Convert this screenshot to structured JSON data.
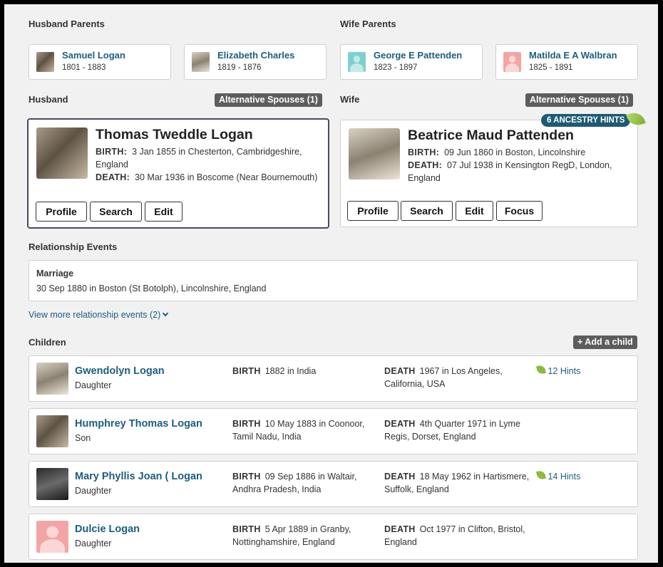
{
  "husband_parents": {
    "label": "Husband Parents",
    "father": {
      "name": "Samuel Logan",
      "dates": "1801 - 1883"
    },
    "mother": {
      "name": "Elizabeth Charles",
      "dates": "1819 - 1876"
    }
  },
  "wife_parents": {
    "label": "Wife Parents",
    "father": {
      "name": "George E Pattenden",
      "dates": "1823 - 1897"
    },
    "mother": {
      "name": "Matilda E A Walbran",
      "dates": "1825 - 1891"
    }
  },
  "husband": {
    "label": "Husband",
    "alt_spouses": "Alternative Spouses (1)",
    "name": "Thomas Tweddle Logan",
    "birth_label": "BIRTH:",
    "birth": "3 Jan 1855 in Chesterton, Cambridgeshire, England",
    "death_label": "DEATH:",
    "death": "30 Mar 1936 in Boscome (Near Bournemouth)",
    "buttons": {
      "profile": "Profile",
      "search": "Search",
      "edit": "Edit"
    }
  },
  "wife": {
    "label": "Wife",
    "alt_spouses": "Alternative Spouses (1)",
    "hints": "6 ANCESTRY HINTS",
    "name": "Beatrice Maud Pattenden",
    "birth_label": "BIRTH:",
    "birth": "09 Jun 1860 in Boston, Lincolnshire",
    "death_label": "DEATH:",
    "death": "07 Jul 1938 in Kensington RegD, London, England",
    "buttons": {
      "profile": "Profile",
      "search": "Search",
      "edit": "Edit",
      "focus": "Focus"
    }
  },
  "relationship": {
    "label": "Relationship Events",
    "event_title": "Marriage",
    "event_detail": "30 Sep 1880 in Boston (St Botolph), Lincolnshire, England",
    "view_more": "View more relationship events (2)"
  },
  "children": {
    "label": "Children",
    "add_button": "+ Add a child",
    "birth_label": "BIRTH",
    "death_label": "DEATH",
    "items": [
      {
        "name": "Gwendolyn Logan",
        "relation": "Daughter",
        "birth": "1882  in India",
        "death": "1967  in Los Angeles, California, USA",
        "hints": "12 Hints"
      },
      {
        "name": "Humphrey Thomas Logan",
        "relation": "Son",
        "birth": "10 May 1883  in Coonoor, Tamil Nadu, India",
        "death": "4th Quarter 1971  in Lyme Regis, Dorset, England",
        "hints": ""
      },
      {
        "name": "Mary Phyllis Joan ( Logan",
        "relation": "Daughter",
        "birth": "09 Sep 1886  in Waltair, Andhra Pradesh, India",
        "death": "18 May 1962  in Hartismere, Suffolk, England",
        "hints": "14 Hints"
      },
      {
        "name": "Dulcie Logan",
        "relation": "Daughter",
        "birth": "5 Apr 1889  in Granby, Nottinghamshire, England",
        "death": "Oct 1977  in Clifton, Bristol, England",
        "hints": ""
      }
    ]
  },
  "colors": {
    "link": "#1c5d80",
    "badge": "#5d5d5d",
    "hint_pill": "#1d5a74",
    "leaf": "#8dbb3c"
  }
}
